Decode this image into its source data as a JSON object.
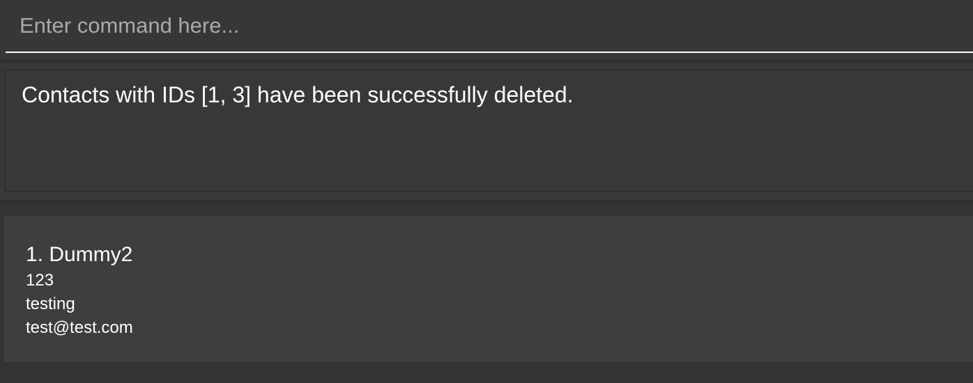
{
  "command_box": {
    "placeholder": "Enter command here...",
    "value": ""
  },
  "result_display": {
    "message": "Contacts with IDs [1, 3] have been successfully deleted."
  },
  "contacts": [
    {
      "index_name": "1. Dummy2",
      "phone": "123",
      "address": "testing",
      "email": "test@test.com"
    }
  ],
  "colors": {
    "background": "#2f2f2f",
    "card": "#3c3e3f",
    "text": "#ffffff",
    "placeholder": "#a9a9a9"
  }
}
